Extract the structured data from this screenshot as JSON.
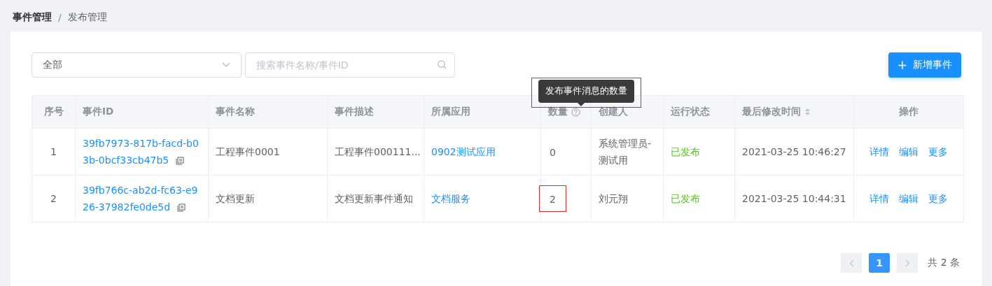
{
  "breadcrumb": [
    {
      "label": "事件管理",
      "current": false
    },
    {
      "label": "发布管理",
      "current": true
    }
  ],
  "breadcrumb_separator": "/",
  "filter": {
    "value": "全部"
  },
  "search": {
    "placeholder": "搜索事件名称/事件ID"
  },
  "add_button": {
    "icon": "+",
    "label": "新增事件"
  },
  "tooltip": {
    "text": "发布事件消息的数量",
    "highlighted": true
  },
  "table": {
    "columns": [
      {
        "label": "序号",
        "kind": "plain"
      },
      {
        "label": "事件ID",
        "kind": "plain"
      },
      {
        "label": "事件名称",
        "kind": "plain"
      },
      {
        "label": "事件描述",
        "kind": "plain"
      },
      {
        "label": "所属应用",
        "kind": "plain"
      },
      {
        "label": "数量",
        "kind": "help"
      },
      {
        "label": "创建人",
        "kind": "plain"
      },
      {
        "label": "运行状态",
        "kind": "plain"
      },
      {
        "label": "最后修改时间",
        "kind": "sort"
      },
      {
        "label": "操作",
        "kind": "center"
      }
    ],
    "rows": [
      {
        "index": "1",
        "event_id": "39fb7973-817b-facd-b03b-0bcf33cb47b5",
        "name": "工程事件0001",
        "description": "工程事件000111...",
        "app": "0902测试应用",
        "count": "0",
        "count_highlighted": false,
        "creator": "系统管理员-测试用",
        "status": "已发布",
        "modified": "2021-03-25 10:46:27",
        "actions": [
          "详情",
          "编辑",
          "更多"
        ]
      },
      {
        "index": "2",
        "event_id": "39fb766c-ab2d-fc63-e926-37982fe0de5d",
        "name": "文档更新",
        "description": "文档更新事件通知",
        "app": "文档服务",
        "count": "2",
        "count_highlighted": true,
        "creator": "刘元翔",
        "status": "已发布",
        "modified": "2021-03-25 10:44:31",
        "actions": [
          "详情",
          "编辑",
          "更多"
        ]
      }
    ]
  },
  "pagination": {
    "pages": [
      {
        "label": "1",
        "selected": true
      }
    ],
    "total": "共 2 条"
  }
}
